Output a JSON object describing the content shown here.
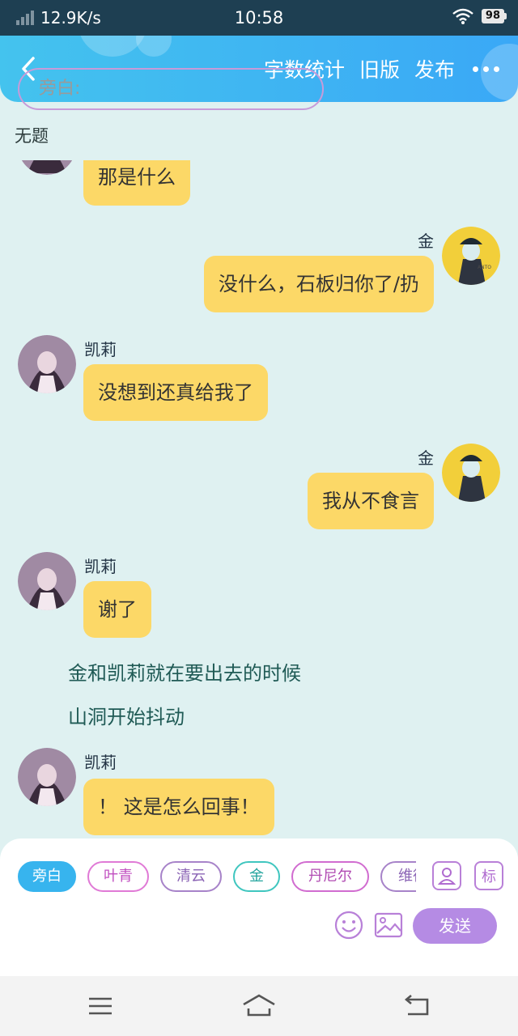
{
  "status_bar": {
    "speed": "12.9K/s",
    "time": "10:58",
    "battery": "98"
  },
  "header": {
    "back_icon": "chevron-left-icon",
    "actions": [
      "字数统计",
      "旧版",
      "发布"
    ],
    "more_icon": "more-dots-icon"
  },
  "page": {
    "title": "无题"
  },
  "messages": [
    {
      "side": "left",
      "speaker": "",
      "text": "那是什么"
    },
    {
      "side": "right",
      "speaker": "金",
      "text": "没什么，石板归你了/扔"
    },
    {
      "side": "left",
      "speaker": "凯莉",
      "text": "没想到还真给我了"
    },
    {
      "side": "right",
      "speaker": "金",
      "text": "我从不食言"
    },
    {
      "side": "left",
      "speaker": "凯莉",
      "text": "谢了"
    },
    {
      "side": "left",
      "speaker": "凯莉",
      "text": "！ 这是怎么回事！"
    }
  ],
  "narration": [
    "金和凯莉就在要出去的时候",
    "山洞开始抖动"
  ],
  "composer": {
    "roles": [
      "旁白",
      "叶青",
      "清云",
      "金",
      "丹尼尔",
      "维德"
    ],
    "placeholder": "旁白:",
    "send_label": "发送",
    "tag_label": "标",
    "colors": {
      "active": "#37b4ee",
      "send": "#b58be4",
      "bubble": "#fcd867"
    }
  }
}
